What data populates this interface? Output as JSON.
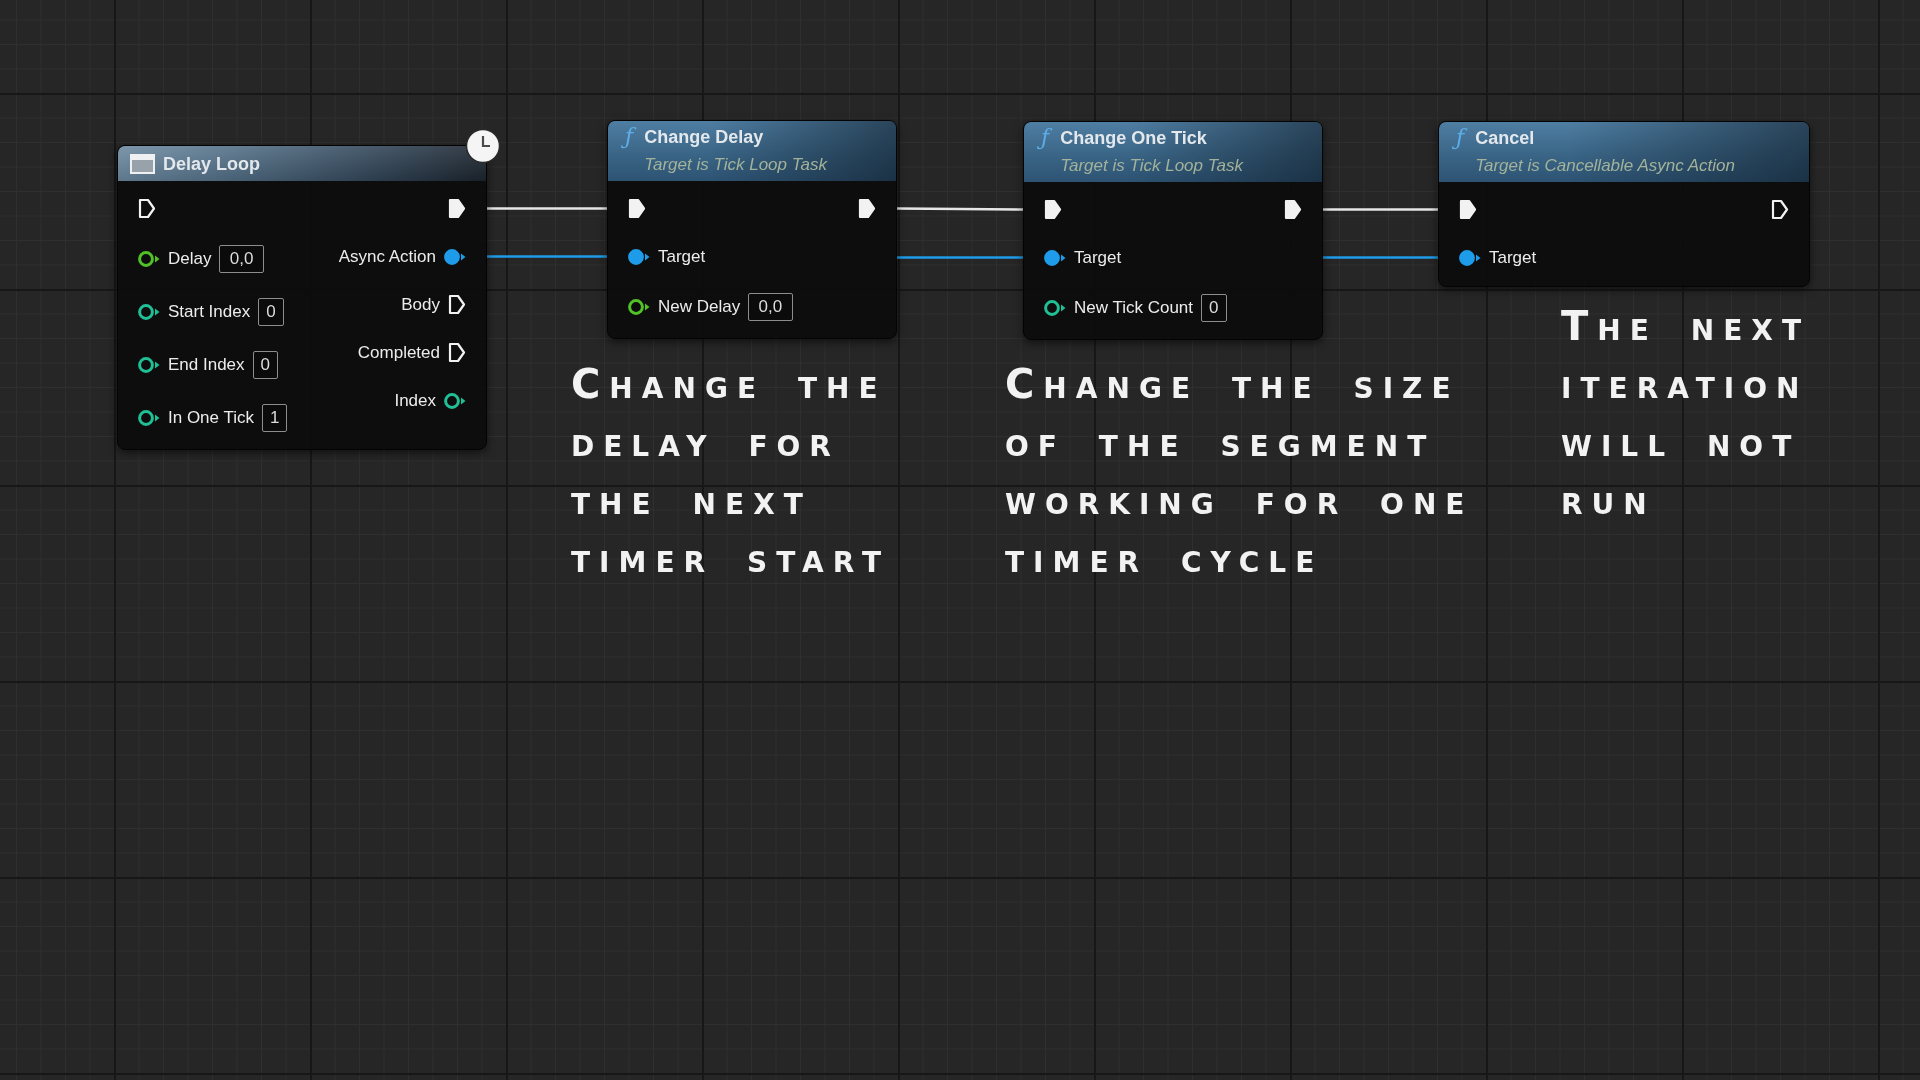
{
  "nodes": [
    {
      "kind": "macro",
      "title": "Delay Loop",
      "latent": true,
      "inputs": [
        {
          "kind": "exec",
          "connected": false
        },
        {
          "kind": "float",
          "label": "Delay",
          "value": "0,0",
          "connected": false
        },
        {
          "kind": "int",
          "label": "Start Index",
          "value": "0",
          "connected": false
        },
        {
          "kind": "int",
          "label": "End Index",
          "value": "0",
          "connected": false
        },
        {
          "kind": "int",
          "label": "In One Tick",
          "value": "1",
          "connected": false
        }
      ],
      "outputs": [
        {
          "kind": "exec",
          "connected": true
        },
        {
          "kind": "object",
          "label": "Async Action",
          "connected": true
        },
        {
          "kind": "exec",
          "label": "Body",
          "connected": false
        },
        {
          "kind": "exec",
          "label": "Completed",
          "connected": false
        },
        {
          "kind": "int",
          "label": "Index",
          "connected": false
        }
      ]
    },
    {
      "kind": "function",
      "icon": "ƒ",
      "title": "Change Delay",
      "subtitle": "Target is Tick Loop Task",
      "latent": false,
      "inputs": [
        {
          "kind": "exec",
          "connected": true
        },
        {
          "kind": "object",
          "label": "Target",
          "connected": true
        },
        {
          "kind": "float",
          "label": "New Delay",
          "value": "0,0",
          "connected": false
        }
      ],
      "outputs": [
        {
          "kind": "exec",
          "connected": true
        }
      ]
    },
    {
      "kind": "function",
      "icon": "ƒ",
      "title": "Change One Tick",
      "subtitle": "Target is Tick Loop Task",
      "latent": false,
      "inputs": [
        {
          "kind": "exec",
          "connected": true
        },
        {
          "kind": "object",
          "label": "Target",
          "connected": true
        },
        {
          "kind": "int",
          "label": "New Tick Count",
          "value": "0",
          "connected": false
        }
      ],
      "outputs": [
        {
          "kind": "exec",
          "connected": true
        }
      ]
    },
    {
      "kind": "function",
      "icon": "ƒ",
      "title": "Cancel",
      "subtitle": "Target is Cancellable Async Action",
      "latent": false,
      "inputs": [
        {
          "kind": "exec",
          "connected": true
        },
        {
          "kind": "object",
          "label": "Target",
          "connected": true
        }
      ],
      "outputs": [
        {
          "kind": "exec",
          "connected": false
        }
      ]
    }
  ],
  "captions": [
    "Change the delay for the next timer start",
    "Change the size of the segment working for one timer cycle",
    "The next iteration will not run"
  ]
}
